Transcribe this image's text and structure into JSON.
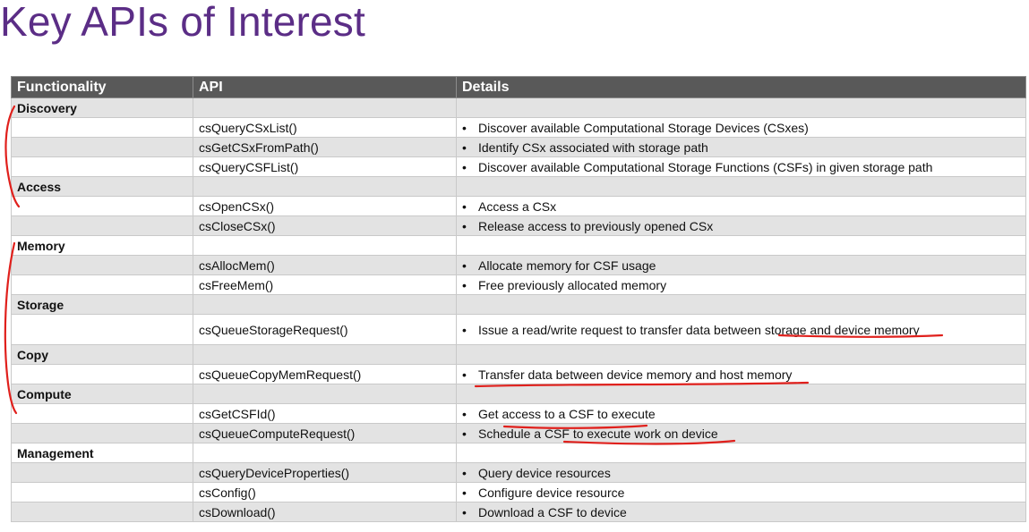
{
  "title": "Key APIs of Interest",
  "table": {
    "headers": [
      "Functionality",
      "API",
      "Details"
    ],
    "rows": [
      {
        "category": "Discovery",
        "api": "",
        "detail": ""
      },
      {
        "category": "",
        "api": "csQueryCSxList()",
        "detail": "Discover available Computational Storage Devices (CSxes)"
      },
      {
        "category": "",
        "api": "csGetCSxFromPath()",
        "detail": "Identify CSx associated with storage path"
      },
      {
        "category": "",
        "api": "csQueryCSFList()",
        "detail": "Discover available Computational Storage Functions (CSFs) in given storage path"
      },
      {
        "category": "Access",
        "api": "",
        "detail": ""
      },
      {
        "category": "",
        "api": "csOpenCSx()",
        "detail": "Access a CSx"
      },
      {
        "category": "",
        "api": "csCloseCSx()",
        "detail": "Release access to previously opened CSx"
      },
      {
        "category": "Memory",
        "api": "",
        "detail": ""
      },
      {
        "category": "",
        "api": "csAllocMem()",
        "detail": "Allocate memory for CSF usage"
      },
      {
        "category": "",
        "api": "csFreeMem()",
        "detail": "Free previously allocated memory"
      },
      {
        "category": "Storage",
        "api": "",
        "detail": ""
      },
      {
        "category": "",
        "api": "csQueueStorageRequest()",
        "detail": "Issue a read/write request to transfer data between storage and device memory",
        "tall": true
      },
      {
        "category": "Copy",
        "api": "",
        "detail": ""
      },
      {
        "category": "",
        "api": "csQueueCopyMemRequest()",
        "detail": "Transfer data between device memory and host memory"
      },
      {
        "category": "Compute",
        "api": "",
        "detail": ""
      },
      {
        "category": "",
        "api": "csGetCSFId()",
        "detail": "Get access to a CSF to execute"
      },
      {
        "category": "",
        "api": "csQueueComputeRequest()",
        "detail": "Schedule a CSF to execute work on device"
      },
      {
        "category": "Management",
        "api": "",
        "detail": ""
      },
      {
        "category": "",
        "api": "csQueryDeviceProperties()",
        "detail": "Query device resources"
      },
      {
        "category": "",
        "api": "csConfig()",
        "detail": "Configure device resource"
      },
      {
        "category": "",
        "api": "csDownload()",
        "detail": "Download a CSF to device"
      }
    ]
  },
  "bullet_char": "•",
  "annotation_color": "#e0201c"
}
